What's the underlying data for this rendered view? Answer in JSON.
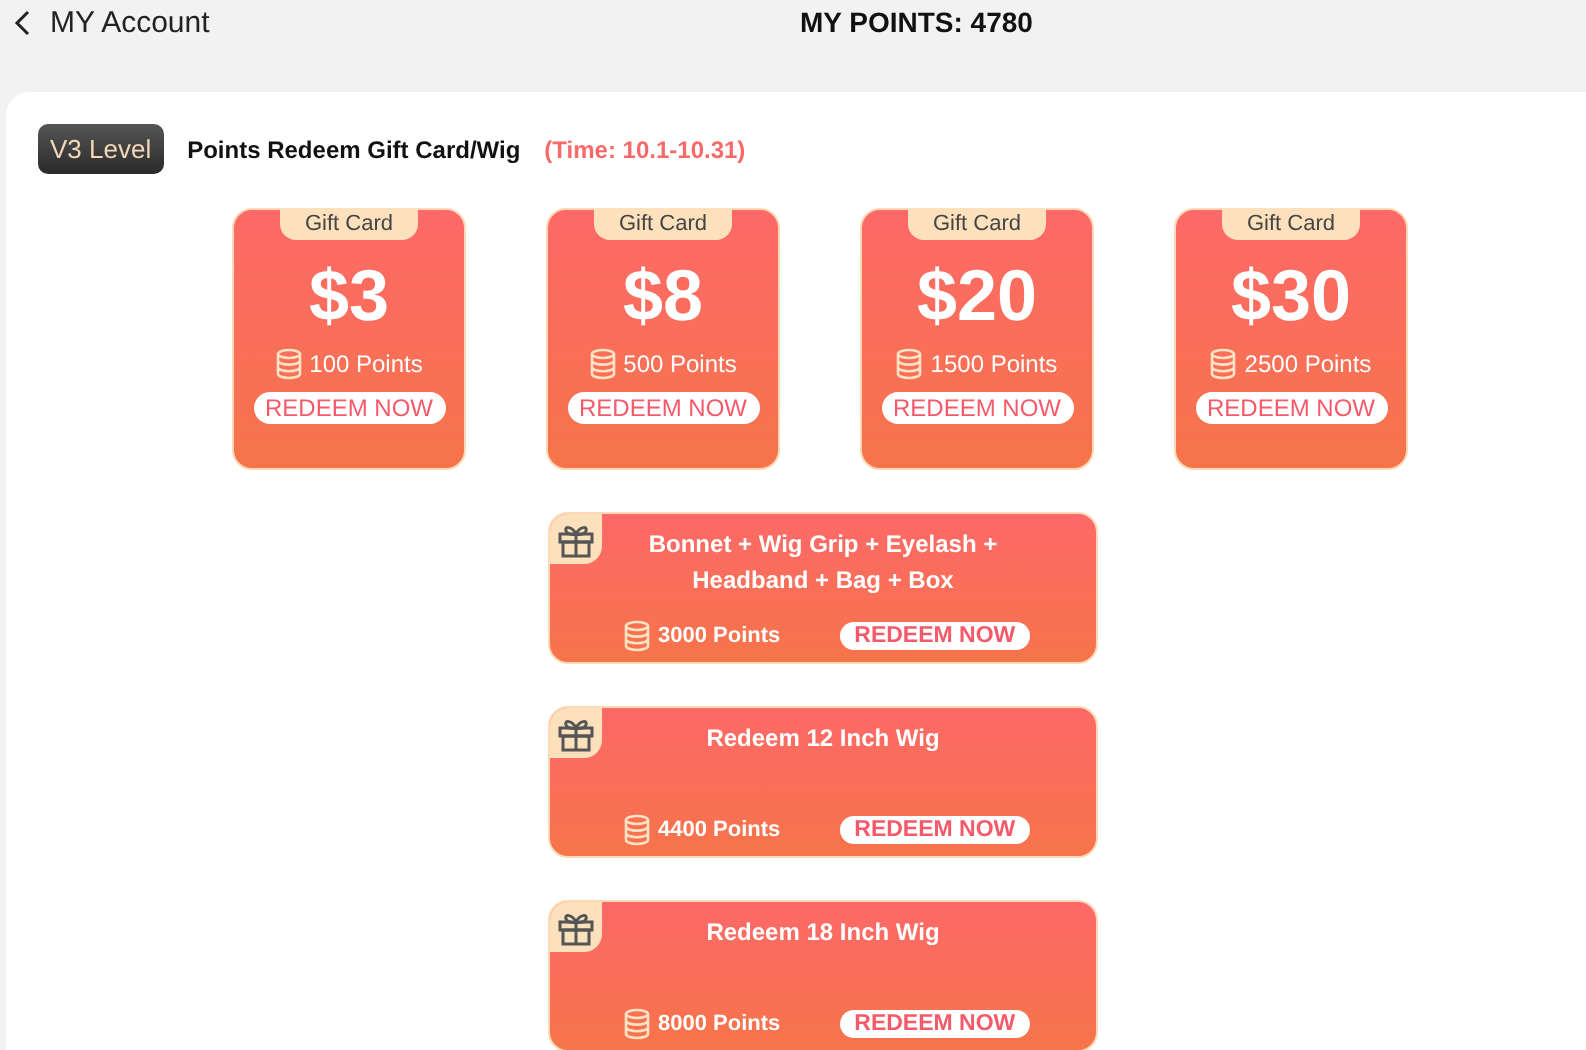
{
  "header": {
    "back_label": "MY Account",
    "points": "MY POINTS: 4780"
  },
  "section": {
    "level": "V3 Level",
    "title": "Points Redeem Gift Card/Wig",
    "time": "(Time: 10.1-10.31)"
  },
  "gift_cards": [
    {
      "tag": "Gift Card",
      "amount": "$3",
      "points": "100 Points",
      "button": "REDEEM NOW"
    },
    {
      "tag": "Gift Card",
      "amount": "$8",
      "points": "500 Points",
      "button": "REDEEM NOW"
    },
    {
      "tag": "Gift Card",
      "amount": "$20",
      "points": "1500 Points",
      "button": "REDEEM NOW"
    },
    {
      "tag": "Gift Card",
      "amount": "$30",
      "points": "2500 Points",
      "button": "REDEEM NOW"
    }
  ],
  "products": [
    {
      "title": "Bonnet + Wig Grip + Eyelash + Headband + Bag + Box",
      "points": "3000 Points",
      "button": "REDEEM NOW"
    },
    {
      "title": "Redeem 12 Inch Wig",
      "points": "4400 Points",
      "button": "REDEEM NOW"
    },
    {
      "title": "Redeem 18 Inch Wig",
      "points": "8000 Points",
      "button": "REDEEM NOW"
    }
  ]
}
